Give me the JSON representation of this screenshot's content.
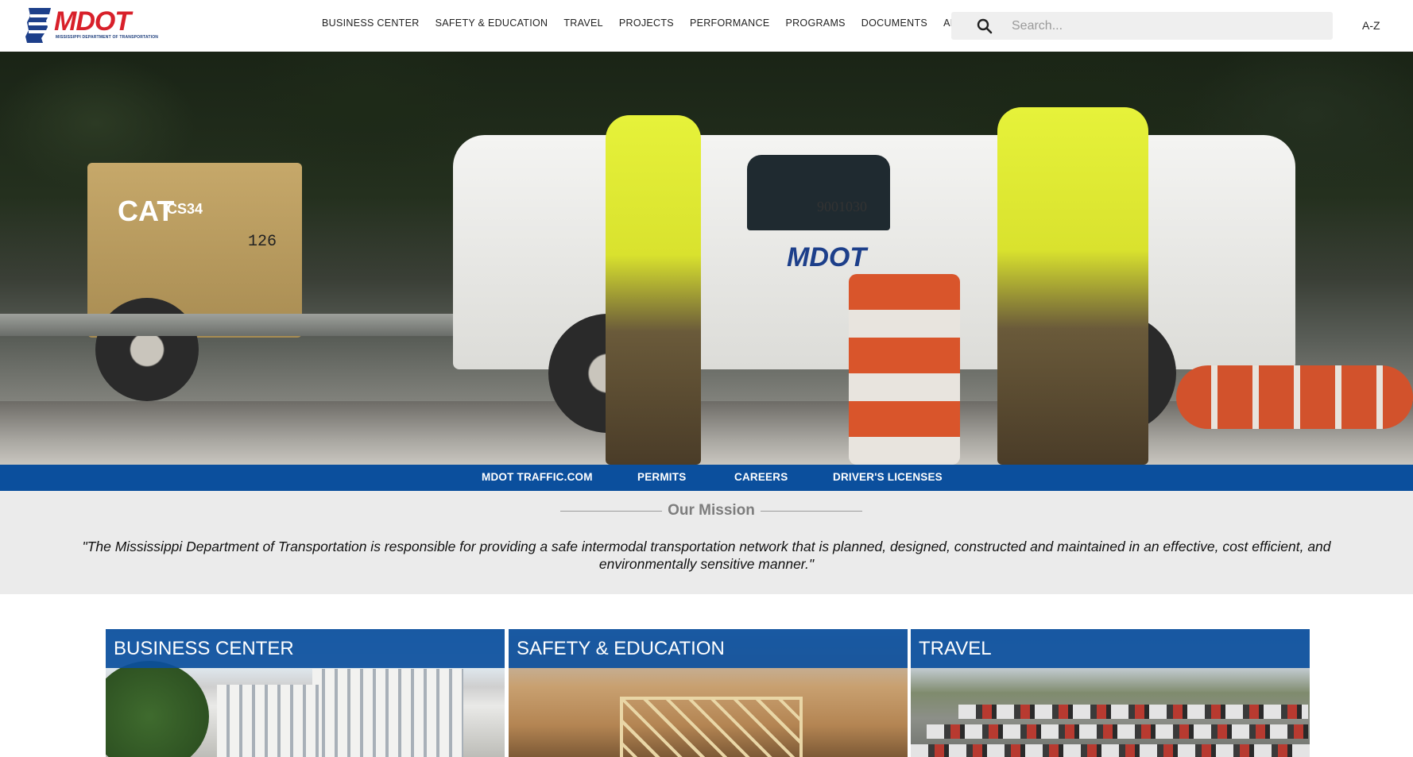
{
  "header": {
    "logo_text": "MDOT",
    "logo_subtext": "MISSISSIPPI DEPARTMENT OF TRANSPORTATION",
    "nav": [
      {
        "label": "BUSINESS CENTER"
      },
      {
        "label": "SAFETY & EDUCATION"
      },
      {
        "label": "TRAVEL"
      },
      {
        "label": "PROJECTS"
      },
      {
        "label": "PERFORMANCE"
      },
      {
        "label": "PROGRAMS"
      },
      {
        "label": "DOCUMENTS"
      },
      {
        "label": "ABOUT"
      }
    ],
    "search_placeholder": "Search...",
    "az_label": "A-Z"
  },
  "hero": {
    "compressor_brand": "CAT",
    "compressor_model": "CS34",
    "compressor_number": "126",
    "truck_number": "9001030",
    "truck_logo": "MDOT"
  },
  "quicklinks": [
    {
      "label": "MDOT TRAFFIC.COM"
    },
    {
      "label": "PERMITS"
    },
    {
      "label": "CAREERS"
    },
    {
      "label": "DRIVER'S LICENSES"
    }
  ],
  "mission": {
    "title": "Our Mission",
    "text": "\"The Mississippi Department of Transportation is responsible for providing a safe intermodal transportation network that is planned, designed, constructed and maintained in an effective, cost efficient, and environmentally sensitive manner.\""
  },
  "cards": [
    {
      "title": "BUSINESS CENTER"
    },
    {
      "title": "SAFETY & EDUCATION"
    },
    {
      "title": "TRAVEL"
    }
  ],
  "colors": {
    "brand_blue": "#0b4f9d",
    "logo_red": "#d8202a",
    "mission_bg": "#ebebeb"
  },
  "icons": {
    "search": "search-icon",
    "logo": "mississippi-state-icon"
  }
}
